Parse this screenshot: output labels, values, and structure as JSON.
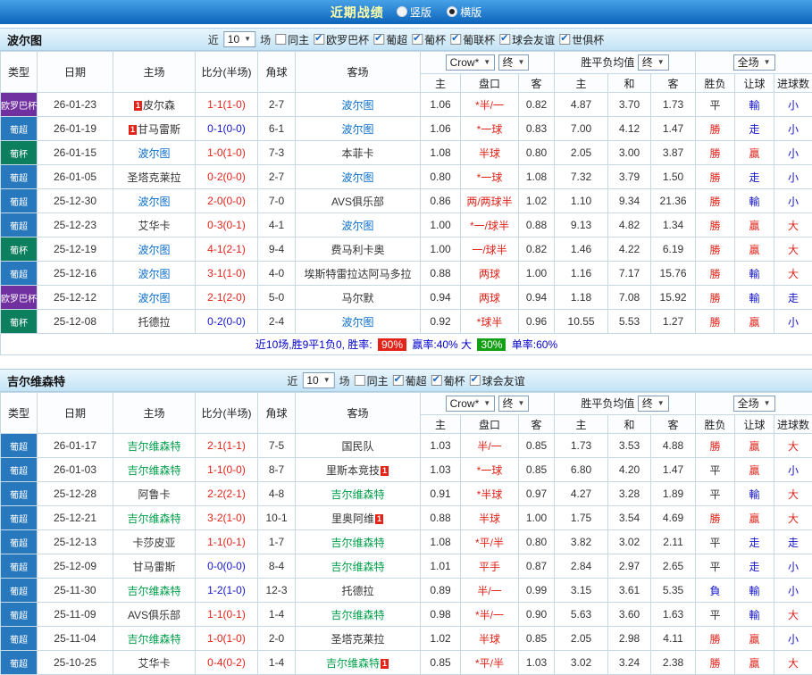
{
  "topbar": {
    "title": "近期战绩",
    "radios": [
      {
        "label": "竖版",
        "selected": false
      },
      {
        "label": "横版",
        "selected": true
      }
    ]
  },
  "league_colors": {
    "欧罗巴杯": "#7030a0",
    "葡超": "#2878be",
    "葡杯": "#0b7f5e"
  },
  "score_colors": {
    "red": "#e2231a",
    "blue": "#1414cc",
    "dark": "#333333"
  },
  "result_colors": {
    "勝": "#e2231a",
    "贏": "#e2231a",
    "大": "#e2231a",
    "平": "#333333",
    "負": "#1414cc",
    "輸": "#1414cc",
    "走": "#1414cc",
    "小": "#1414cc"
  },
  "table_header": {
    "cols": [
      "类型",
      "日期",
      "主场",
      "比分(半场)",
      "角球",
      "客场"
    ],
    "crow": "Crow*",
    "end": "终",
    "mean": "胜平负均值",
    "full": "全场",
    "sub": [
      "主",
      "盘口",
      "客",
      "主",
      "和",
      "客",
      "胜负",
      "让球",
      "进球数"
    ]
  },
  "sections": [
    {
      "team": "波尔图",
      "team_color": "#0a6ecd",
      "filter": {
        "near": "近",
        "count": "10",
        "games": "场",
        "options": [
          {
            "label": "同主",
            "checked": false
          },
          {
            "label": "欧罗巴杯",
            "checked": true
          },
          {
            "label": "葡超",
            "checked": true
          },
          {
            "label": "葡杯",
            "checked": true
          },
          {
            "label": "葡联杯",
            "checked": true
          },
          {
            "label": "球会友谊",
            "checked": true
          },
          {
            "label": "世俱杯",
            "checked": true
          }
        ]
      },
      "rows": [
        {
          "league": "欧罗巴杯",
          "date": "26-01-23",
          "home": "皮尔森",
          "homeBadge": "before",
          "score": "1-1(1-0)",
          "scoreColor": "red",
          "corner": "2-7",
          "away": "波尔图",
          "awayTeam": true,
          "o1": "1.06",
          "pan": "*半/一",
          "o2": "0.82",
          "m1": "4.87",
          "m2": "3.70",
          "m3": "1.73",
          "r1": "平",
          "r2": "輸",
          "r3": "小"
        },
        {
          "league": "葡超",
          "date": "26-01-19",
          "home": "甘马雷斯",
          "homeBadge": "before",
          "score": "0-1(0-0)",
          "scoreColor": "blue",
          "corner": "6-1",
          "away": "波尔图",
          "awayTeam": true,
          "o1": "1.06",
          "pan": "*一球",
          "o2": "0.83",
          "m1": "7.00",
          "m2": "4.12",
          "m3": "1.47",
          "r1": "勝",
          "r2": "走",
          "r3": "小"
        },
        {
          "league": "葡杯",
          "date": "26-01-15",
          "home": "波尔图",
          "homeTeam": true,
          "score": "1-0(1-0)",
          "scoreColor": "red",
          "corner": "7-3",
          "away": "本菲卡",
          "o1": "1.08",
          "pan": "半球",
          "o2": "0.80",
          "m1": "2.05",
          "m2": "3.00",
          "m3": "3.87",
          "r1": "勝",
          "r2": "贏",
          "r3": "小"
        },
        {
          "league": "葡超",
          "date": "26-01-05",
          "home": "圣塔克莱拉",
          "score": "0-2(0-0)",
          "scoreColor": "red",
          "corner": "2-7",
          "away": "波尔图",
          "awayTeam": true,
          "o1": "0.80",
          "pan": "*一球",
          "o2": "1.08",
          "m1": "7.32",
          "m2": "3.79",
          "m3": "1.50",
          "r1": "勝",
          "r2": "走",
          "r3": "小"
        },
        {
          "league": "葡超",
          "date": "25-12-30",
          "home": "波尔图",
          "homeTeam": true,
          "score": "2-0(0-0)",
          "scoreColor": "red",
          "corner": "7-0",
          "away": "AVS俱乐部",
          "o1": "0.86",
          "pan": "两/两球半",
          "o2": "1.02",
          "m1": "1.10",
          "m2": "9.34",
          "m3": "21.36",
          "r1": "勝",
          "r2": "輸",
          "r3": "小"
        },
        {
          "league": "葡超",
          "date": "25-12-23",
          "home": "艾华卡",
          "score": "0-3(0-1)",
          "scoreColor": "red",
          "corner": "4-1",
          "away": "波尔图",
          "awayTeam": true,
          "o1": "1.00",
          "pan": "*一/球半",
          "o2": "0.88",
          "m1": "9.13",
          "m2": "4.82",
          "m3": "1.34",
          "r1": "勝",
          "r2": "贏",
          "r3": "大"
        },
        {
          "league": "葡杯",
          "date": "25-12-19",
          "home": "波尔图",
          "homeTeam": true,
          "score": "4-1(2-1)",
          "scoreColor": "red",
          "corner": "9-4",
          "away": "费马利卡奥",
          "o1": "1.00",
          "pan": "一/球半",
          "o2": "0.82",
          "m1": "1.46",
          "m2": "4.22",
          "m3": "6.19",
          "r1": "勝",
          "r2": "贏",
          "r3": "大"
        },
        {
          "league": "葡超",
          "date": "25-12-16",
          "home": "波尔图",
          "homeTeam": true,
          "score": "3-1(1-0)",
          "scoreColor": "red",
          "corner": "4-0",
          "away": "埃斯特雷拉达阿马多拉",
          "o1": "0.88",
          "pan": "两球",
          "o2": "1.00",
          "m1": "1.16",
          "m2": "7.17",
          "m3": "15.76",
          "r1": "勝",
          "r2": "輸",
          "r3": "大"
        },
        {
          "league": "欧罗巴杯",
          "date": "25-12-12",
          "home": "波尔图",
          "homeTeam": true,
          "score": "2-1(2-0)",
          "scoreColor": "red",
          "corner": "5-0",
          "away": "马尔默",
          "o1": "0.94",
          "pan": "两球",
          "o2": "0.94",
          "m1": "1.18",
          "m2": "7.08",
          "m3": "15.92",
          "r1": "勝",
          "r2": "輸",
          "r3": "走"
        },
        {
          "league": "葡杯",
          "date": "25-12-08",
          "home": "托德拉",
          "score": "0-2(0-0)",
          "scoreColor": "blue",
          "corner": "2-4",
          "away": "波尔图",
          "awayTeam": true,
          "o1": "0.92",
          "pan": "*球半",
          "o2": "0.96",
          "m1": "10.55",
          "m2": "5.53",
          "m3": "1.27",
          "r1": "勝",
          "r2": "贏",
          "r3": "小"
        }
      ],
      "summary": {
        "prefix": "近10场,胜9平1负0, 胜率:",
        "win": "90%",
        "mid": "赢率:40% 大",
        "big": "30%",
        "suffix": "单率:60%"
      }
    },
    {
      "team": "吉尔维森特",
      "team_color": "#00a04a",
      "filter": {
        "near": "近",
        "count": "10",
        "games": "场",
        "options": [
          {
            "label": "同主",
            "checked": false
          },
          {
            "label": "葡超",
            "checked": true
          },
          {
            "label": "葡杯",
            "checked": true
          },
          {
            "label": "球会友谊",
            "checked": true
          }
        ]
      },
      "rows": [
        {
          "league": "葡超",
          "date": "26-01-17",
          "home": "吉尔维森特",
          "homeTeam": true,
          "score": "2-1(1-1)",
          "scoreColor": "red",
          "corner": "7-5",
          "away": "国民队",
          "o1": "1.03",
          "pan": "半/一",
          "o2": "0.85",
          "m1": "1.73",
          "m2": "3.53",
          "m3": "4.88",
          "r1": "勝",
          "r2": "贏",
          "r3": "大"
        },
        {
          "league": "葡超",
          "date": "26-01-03",
          "home": "吉尔维森特",
          "homeTeam": true,
          "score": "1-1(0-0)",
          "scoreColor": "red",
          "corner": "8-7",
          "away": "里斯本竞技",
          "awayBadge": "after",
          "o1": "1.03",
          "pan": "*一球",
          "o2": "0.85",
          "m1": "6.80",
          "m2": "4.20",
          "m3": "1.47",
          "r1": "平",
          "r2": "贏",
          "r3": "小"
        },
        {
          "league": "葡超",
          "date": "25-12-28",
          "home": "阿鲁卡",
          "score": "2-2(2-1)",
          "scoreColor": "red",
          "corner": "4-8",
          "away": "吉尔维森特",
          "awayTeam": true,
          "o1": "0.91",
          "pan": "*半球",
          "o2": "0.97",
          "m1": "4.27",
          "m2": "3.28",
          "m3": "1.89",
          "r1": "平",
          "r2": "輸",
          "r3": "大"
        },
        {
          "league": "葡超",
          "date": "25-12-21",
          "home": "吉尔维森特",
          "homeTeam": true,
          "score": "3-2(1-0)",
          "scoreColor": "red",
          "corner": "10-1",
          "away": "里奥阿维",
          "awayBadge": "after",
          "o1": "0.88",
          "pan": "半球",
          "o2": "1.00",
          "m1": "1.75",
          "m2": "3.54",
          "m3": "4.69",
          "r1": "勝",
          "r2": "贏",
          "r3": "大"
        },
        {
          "league": "葡超",
          "date": "25-12-13",
          "home": "卡莎皮亚",
          "score": "1-1(0-1)",
          "scoreColor": "red",
          "corner": "1-7",
          "away": "吉尔维森特",
          "awayTeam": true,
          "o1": "1.08",
          "pan": "*平/半",
          "o2": "0.80",
          "m1": "3.82",
          "m2": "3.02",
          "m3": "2.11",
          "r1": "平",
          "r2": "走",
          "r3": "走"
        },
        {
          "league": "葡超",
          "date": "25-12-09",
          "home": "甘马雷斯",
          "score": "0-0(0-0)",
          "scoreColor": "blue",
          "corner": "8-4",
          "away": "吉尔维森特",
          "awayTeam": true,
          "o1": "1.01",
          "pan": "平手",
          "o2": "0.87",
          "m1": "2.84",
          "m2": "2.97",
          "m3": "2.65",
          "r1": "平",
          "r2": "走",
          "r3": "小"
        },
        {
          "league": "葡超",
          "date": "25-11-30",
          "home": "吉尔维森特",
          "homeTeam": true,
          "score": "1-2(1-0)",
          "scoreColor": "blue",
          "corner": "12-3",
          "away": "托德拉",
          "o1": "0.89",
          "pan": "半/一",
          "o2": "0.99",
          "m1": "3.15",
          "m2": "3.61",
          "m3": "5.35",
          "r1": "負",
          "r2": "輸",
          "r3": "小"
        },
        {
          "league": "葡超",
          "date": "25-11-09",
          "home": "AVS俱乐部",
          "score": "1-1(0-1)",
          "scoreColor": "red",
          "corner": "1-4",
          "away": "吉尔维森特",
          "awayTeam": true,
          "o1": "0.98",
          "pan": "*半/一",
          "o2": "0.90",
          "m1": "5.63",
          "m2": "3.60",
          "m3": "1.63",
          "r1": "平",
          "r2": "輸",
          "r3": "大"
        },
        {
          "league": "葡超",
          "date": "25-11-04",
          "home": "吉尔维森特",
          "homeTeam": true,
          "score": "1-0(1-0)",
          "scoreColor": "red",
          "corner": "2-0",
          "away": "圣塔克莱拉",
          "o1": "1.02",
          "pan": "半球",
          "o2": "0.85",
          "m1": "2.05",
          "m2": "2.98",
          "m3": "4.11",
          "r1": "勝",
          "r2": "贏",
          "r3": "小"
        },
        {
          "league": "葡超",
          "date": "25-10-25",
          "home": "艾华卡",
          "score": "0-4(0-2)",
          "scoreColor": "red",
          "corner": "1-4",
          "away": "吉尔维森特",
          "awayTeam": true,
          "awayBadge": "after",
          "o1": "0.85",
          "pan": "*平/半",
          "o2": "1.03",
          "m1": "3.02",
          "m2": "3.24",
          "m3": "2.38",
          "r1": "勝",
          "r2": "贏",
          "r3": "大"
        }
      ]
    }
  ]
}
